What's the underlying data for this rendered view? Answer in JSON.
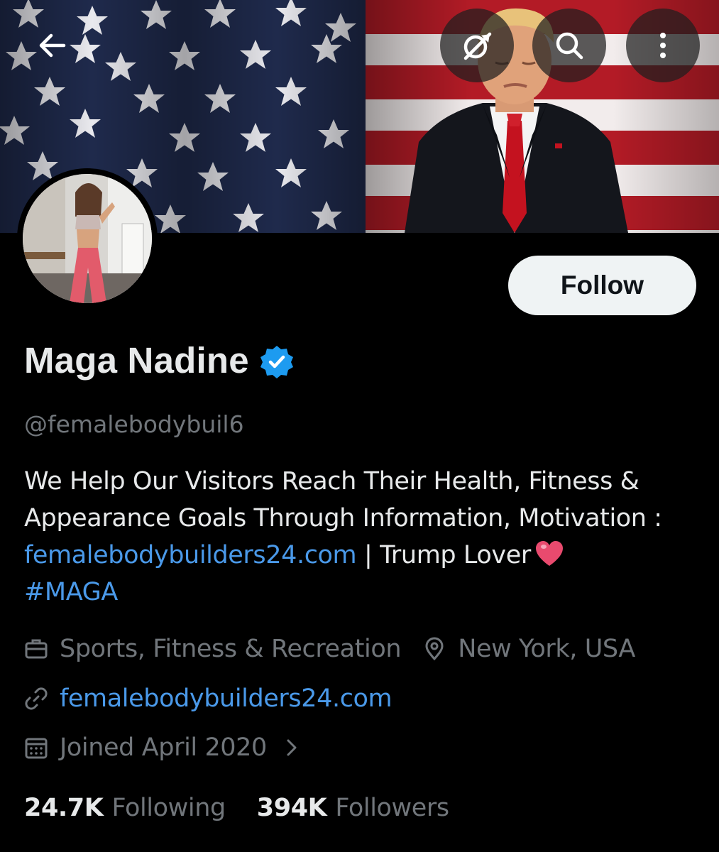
{
  "header": {
    "back_icon": "arrow-left-icon",
    "grok_icon": "grok-icon",
    "search_icon": "search-icon",
    "more_icon": "more-vertical-icon"
  },
  "profile": {
    "display_name": "Maga Nadine",
    "verified": true,
    "handle": "@femalebodybuil6",
    "follow_label": "Follow",
    "bio": {
      "line1": "We Help Our Visitors Reach Their Health, Fitness &",
      "line2": "Appearance Goals Through Information, Motivation :",
      "link": "femalebodybuilders24.com",
      "after_link": " | Trump Lover",
      "hashtag": "#MAGA"
    },
    "category": "Sports, Fitness & Recreation",
    "location": "New York, USA",
    "website": "femalebodybuilders24.com",
    "joined": "Joined April 2020",
    "following_count": "24.7K",
    "following_label": "Following",
    "followers_count": "394K",
    "followers_label": "Followers"
  },
  "colors": {
    "background": "#000000",
    "text_primary": "#e7e9ea",
    "text_secondary": "#71767b",
    "link": "#4a99e9",
    "verified_blue": "#1d9bf0",
    "follow_bg": "#eff3f4"
  }
}
